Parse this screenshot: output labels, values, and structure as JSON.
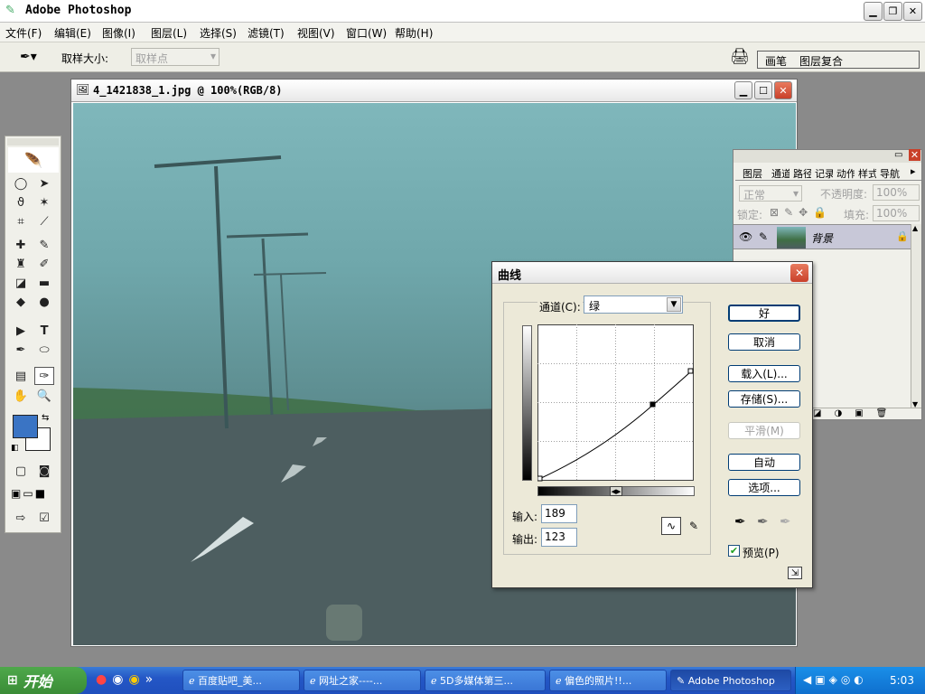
{
  "app": {
    "title": "Adobe Photoshop"
  },
  "menu": [
    "文件(F)",
    "编辑(E)",
    "图像(I)",
    "图层(L)",
    "选择(S)",
    "滤镜(T)",
    "视图(V)",
    "窗口(W)",
    "帮助(H)"
  ],
  "options": {
    "sample_label": "取样大小:",
    "sample_value": "取样点",
    "tab_brush": "画笔",
    "tab_comps": "图层复合"
  },
  "document": {
    "title": "4_1421838_1.jpg @ 100%(RGB/8)"
  },
  "colors": {
    "foreground": "#3a74c4",
    "background": "#ffffff",
    "accent": "#d8392b"
  },
  "layers": {
    "tabs": [
      "图层",
      "通道",
      "路径",
      "记录",
      "动作",
      "样式",
      "导航器"
    ],
    "blend_mode": "正常",
    "opacity_label": "不透明度:",
    "opacity_value": "100%",
    "lock_label": "锁定:",
    "fill_label": "填充:",
    "fill_value": "100%",
    "layer_name": "背景"
  },
  "curves": {
    "title": "曲线",
    "channel_label": "通道(C):",
    "channel_value": "绿",
    "input_label": "输入:",
    "input_value": "189",
    "output_label": "输出:",
    "output_value": "123",
    "buttons": {
      "ok": "好",
      "cancel": "取消",
      "load": "载入(L)...",
      "save": "存储(S)...",
      "smooth": "平滑(M)",
      "auto": "自动",
      "options": "选项..."
    },
    "preview_label": "预览(P)"
  },
  "taskbar": {
    "start": "开始",
    "tasks": [
      "百度贴吧_美...",
      "网址之家----...",
      "5D多媒体第三...",
      "偏色的照片!!...",
      "Adobe Photoshop"
    ],
    "clock": "5:03"
  }
}
